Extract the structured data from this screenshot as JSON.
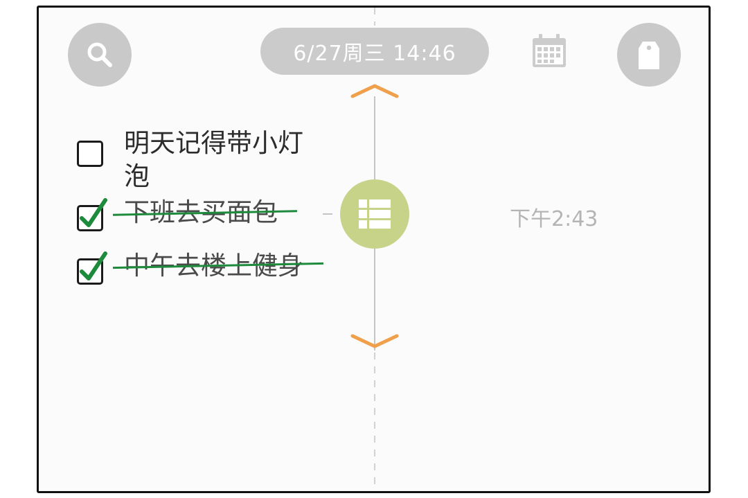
{
  "header": {
    "datetime": "6/27周三  14:46",
    "search_icon": "search-icon",
    "calendar_icon": "calendar-icon",
    "tag_icon": "tag-icon"
  },
  "timeline": {
    "up_icon": "chevron-up-icon",
    "down_icon": "chevron-down-icon",
    "center_icon": "list-icon",
    "center_color": "#c8d38a",
    "chevron_color": "#f0a04b",
    "time_label": "下午2:43"
  },
  "todos": [
    {
      "text": "明天记得带小灯泡",
      "done": false
    },
    {
      "text": "下班去买面包",
      "done": true
    },
    {
      "text": "中午去楼上健身",
      "done": true
    }
  ],
  "colors": {
    "check_green": "#1e8a3c",
    "button_gray": "#c9c9c9"
  }
}
